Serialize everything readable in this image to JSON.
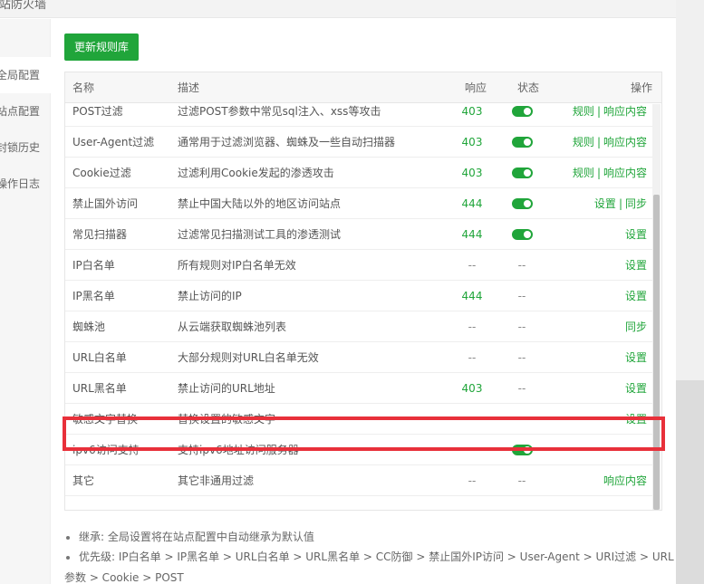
{
  "window": {
    "title": "网站防火墙"
  },
  "sidebar": {
    "items": [
      {
        "label": "全局配置",
        "active": true
      },
      {
        "label": "站点配置",
        "active": false
      },
      {
        "label": "封锁历史",
        "active": false
      },
      {
        "label": "操作日志",
        "active": false
      }
    ]
  },
  "toolbar": {
    "update_label": "更新规则库"
  },
  "table": {
    "headers": {
      "name": "名称",
      "desc": "描述",
      "resp": "响应",
      "state": "状态",
      "ops": "操作"
    },
    "rows": [
      {
        "name": "POST过滤",
        "desc": "过滤POST参数中常见sql注入、xss等攻击",
        "resp": "403",
        "state": "on",
        "ops": [
          "规则",
          "响应内容"
        ]
      },
      {
        "name": "User-Agent过滤",
        "desc": "通常用于过滤浏览器、蜘蛛及一些自动扫描器",
        "resp": "403",
        "state": "on",
        "ops": [
          "规则",
          "响应内容"
        ]
      },
      {
        "name": "Cookie过滤",
        "desc": "过滤利用Cookie发起的渗透攻击",
        "resp": "403",
        "state": "on",
        "ops": [
          "规则",
          "响应内容"
        ]
      },
      {
        "name": "禁止国外访问",
        "desc": "禁止中国大陆以外的地区访问站点",
        "resp": "444",
        "state": "on",
        "ops": [
          "设置",
          "同步"
        ]
      },
      {
        "name": "常见扫描器",
        "desc": "过滤常见扫描测试工具的渗透测试",
        "resp": "444",
        "state": "on",
        "ops": [
          "设置"
        ]
      },
      {
        "name": "IP白名单",
        "desc": "所有规则对IP白名单无效",
        "resp": "--",
        "state": "--",
        "ops": [
          "设置"
        ]
      },
      {
        "name": "IP黑名单",
        "desc": "禁止访问的IP",
        "resp": "444",
        "state": "--",
        "ops": [
          "设置"
        ]
      },
      {
        "name": "蜘蛛池",
        "desc": "从云端获取蜘蛛池列表",
        "resp": "--",
        "state": "--",
        "ops": [
          "同步"
        ]
      },
      {
        "name": "URL白名单",
        "desc": "大部分规则对URL白名单无效",
        "resp": "--",
        "state": "--",
        "ops": [
          "设置"
        ]
      },
      {
        "name": "URL黑名单",
        "desc": "禁止访问的URL地址",
        "resp": "403",
        "state": "--",
        "ops": [
          "设置"
        ]
      },
      {
        "name": "敏感文字替换",
        "desc": "替换设置的敏感文字",
        "resp": "--",
        "state": "--",
        "ops": [
          "设置"
        ]
      },
      {
        "name": "ipv6访问支持",
        "desc": "支持ipv6地址访问服务器",
        "resp": "--",
        "state": "on",
        "ops": [
          "--"
        ]
      },
      {
        "name": "其它",
        "desc": "其它非通用过滤",
        "resp": "--",
        "state": "--",
        "ops": [
          "响应内容"
        ]
      }
    ]
  },
  "notes": {
    "inherit": "继承: 全局设置将在站点配置中自动继承为默认值",
    "priority_line1": "优先级: IP白名单 > IP黑名单 > URL白名单 > URL黑名单 > CC防御 > 禁止国外IP访问 > User-Agent > URI过滤 > URL",
    "priority_line2": "参数 > Cookie > POST"
  },
  "colors": {
    "accent": "#20a53a",
    "highlight": "#e8303a"
  }
}
